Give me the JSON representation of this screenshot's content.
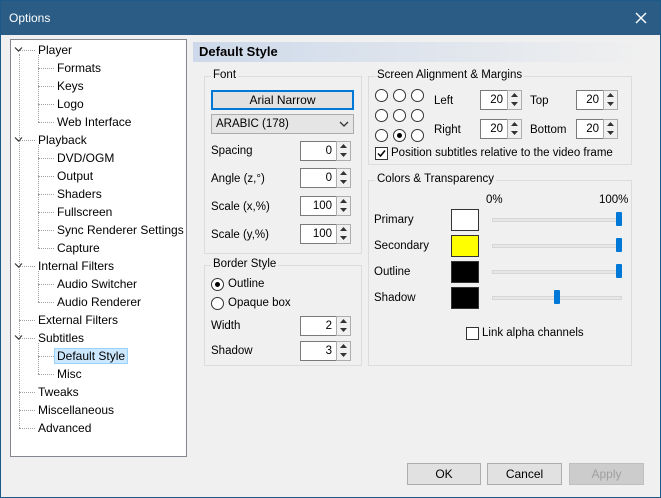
{
  "window": {
    "title": "Options"
  },
  "tree": [
    {
      "label": "Player",
      "level": 0,
      "expanded": true
    },
    {
      "label": "Formats",
      "level": 1
    },
    {
      "label": "Keys",
      "level": 1
    },
    {
      "label": "Logo",
      "level": 1
    },
    {
      "label": "Web Interface",
      "level": 1
    },
    {
      "label": "Playback",
      "level": 0,
      "expanded": true
    },
    {
      "label": "DVD/OGM",
      "level": 1
    },
    {
      "label": "Output",
      "level": 1
    },
    {
      "label": "Shaders",
      "level": 1
    },
    {
      "label": "Fullscreen",
      "level": 1
    },
    {
      "label": "Sync Renderer Settings",
      "level": 1
    },
    {
      "label": "Capture",
      "level": 1
    },
    {
      "label": "Internal Filters",
      "level": 0,
      "expanded": true
    },
    {
      "label": "Audio Switcher",
      "level": 1
    },
    {
      "label": "Audio Renderer",
      "level": 1
    },
    {
      "label": "External Filters",
      "level": 0
    },
    {
      "label": "Subtitles",
      "level": 0,
      "expanded": true
    },
    {
      "label": "Default Style",
      "level": 1,
      "selected": true
    },
    {
      "label": "Misc",
      "level": 1
    },
    {
      "label": "Tweaks",
      "level": 0
    },
    {
      "label": "Miscellaneous",
      "level": 0
    },
    {
      "label": "Advanced",
      "level": 0
    }
  ],
  "page": {
    "title": "Default Style"
  },
  "font": {
    "group_title": "Font",
    "font_button": "Arial Narrow",
    "charset": "ARABIC (178)",
    "spacing_label": "Spacing",
    "spacing": "0",
    "angle_label": "Angle (z,°)",
    "angle": "0",
    "scale_x_label": "Scale (x,%)",
    "scale_x": "100",
    "scale_y_label": "Scale (y,%)",
    "scale_y": "100"
  },
  "border": {
    "group_title": "Border Style",
    "outline_label": "Outline",
    "opaque_label": "Opaque box",
    "selected": "outline",
    "width_label": "Width",
    "width": "2",
    "shadow_label": "Shadow",
    "shadow": "3"
  },
  "alignment": {
    "group_title": "Screen Alignment & Margins",
    "selected_position": "bottom-center",
    "left_label": "Left",
    "left": "20",
    "top_label": "Top",
    "top": "20",
    "right_label": "Right",
    "right": "20",
    "bottom_label": "Bottom",
    "bottom": "20",
    "relative_label": "Position subtitles relative to the video frame",
    "relative_checked": true
  },
  "colors": {
    "group_title": "Colors & Transparency",
    "pct_min": "0%",
    "pct_max": "100%",
    "rows": [
      {
        "label": "Primary",
        "color": "#ffffff",
        "alpha": 1.0
      },
      {
        "label": "Secondary",
        "color": "#ffff00",
        "alpha": 1.0
      },
      {
        "label": "Outline",
        "color": "#000000",
        "alpha": 1.0
      },
      {
        "label": "Shadow",
        "color": "#000000",
        "alpha": 0.5
      }
    ],
    "link_alpha_label": "Link alpha channels",
    "link_alpha_checked": false
  },
  "buttons": {
    "ok": "OK",
    "cancel": "Cancel",
    "apply": "Apply"
  }
}
